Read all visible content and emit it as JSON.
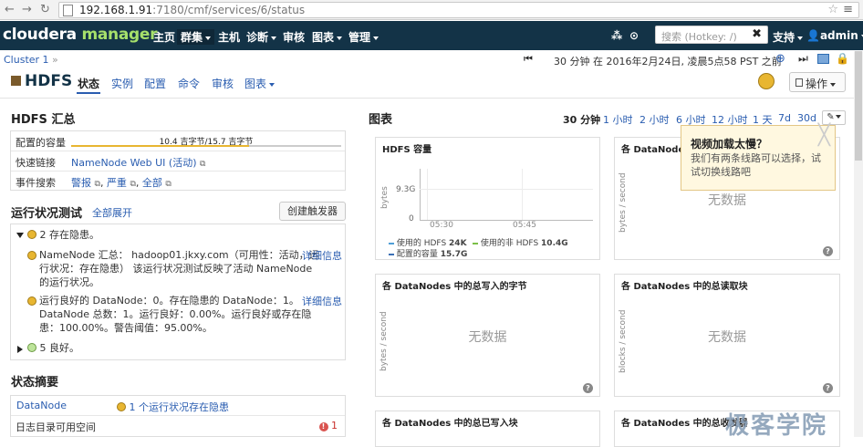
{
  "browser": {
    "url_host": "192.168.1.91",
    "url_rest": ":7180/cmf/services/6/status"
  },
  "header": {
    "logo_a": "cloudera",
    "logo_b": "manager",
    "nav": [
      "主页",
      "群集",
      "主机",
      "诊断",
      "审核",
      "图表",
      "管理"
    ],
    "search_placeholder": "搜索 (Hotkey: /)",
    "support": "支持",
    "user": "admin"
  },
  "breadcrumb": {
    "cluster": "Cluster 1",
    "sep": "»"
  },
  "timeline": {
    "text": "30 分钟 在 2016年2月24日, 凌晨5点58 PST 之前"
  },
  "service": {
    "name": "HDFS",
    "tabs": [
      "状态",
      "实例",
      "配置",
      "命令",
      "审核",
      "图表"
    ],
    "ops_label": "操作"
  },
  "summary": {
    "title": "HDFS 汇总",
    "capacity_label": "配置的容量",
    "capacity_text": "10.4 吉字节/15.7 吉字节",
    "capacity_fraction": 0.66,
    "quicklink_label": "快速链接",
    "quicklink_value": "NameNode Web UI (活动)",
    "events_label": "事件搜索",
    "event_alert": "警报",
    "event_severe": "严重",
    "event_all": "全部"
  },
  "health": {
    "title": "运行状况测试",
    "expand_all": "全部展开",
    "create_trigger": "创建触发器",
    "group_warn": "2 存在隐患。",
    "item1_l1": "NameNode 汇总： hadoop01.jkxy.com（可用性：活动，运",
    "item1_l2": "行状况：存在隐患） 该运行状况测试反映了活动 NameNode",
    "item1_l3": "的运行状况。",
    "item2_l1": "运行良好的 DataNode：0。存在隐患的 DataNode：1。",
    "item2_l2": "DataNode 总数：1。运行良好：0.00%。运行良好或存在隐",
    "item2_l3": "患：100.00%。警告阈值：95.00%。",
    "detail": "详细信息",
    "group_good": "5 良好。"
  },
  "status_summary": {
    "title": "状态摘要",
    "row1_name": "DataNode",
    "row1_value": "1 个运行状况存在隐患",
    "row2_name": "日志目录可用空间",
    "row2_count": "1"
  },
  "charts": {
    "title": "图表",
    "ranges": [
      "30 分钟",
      "1 小时",
      "2 小时",
      "6 小时",
      "12 小时",
      "1 天",
      "7d",
      "30d"
    ],
    "no_data": "无数据",
    "bytes_per_second": "bytes / second",
    "blocks_per_second": "blocks / second",
    "card1": {
      "title": "HDFS 容量",
      "ylabel": "bytes",
      "y_ticks": [
        "9.3G",
        "0"
      ],
      "x_ticks": [
        "05:30",
        "05:45"
      ],
      "legend": [
        {
          "name": "使用的 HDFS",
          "value": "24K",
          "color": "#4f9ed6"
        },
        {
          "name": "使用的非 HDFS",
          "value": "10.4G",
          "color": "#7bbf47"
        },
        {
          "name": "配置的容量",
          "value": "15.7G",
          "color": "#3b6fb5"
        }
      ]
    },
    "card2_title": "各 DataNodes 中",
    "card3_title": "各 DataNodes 中的总写入的字节",
    "card4_title": "各 DataNodes 中的总读取块",
    "card5_title": "各 DataNodes 中的总已写入块",
    "card6_title": "各 DataNodes 中的总收发器"
  },
  "popup": {
    "title": "视频加载太慢？",
    "body": "我们有两条线路可以选择，试试切换线路吧"
  },
  "watermark": "极客学院"
}
